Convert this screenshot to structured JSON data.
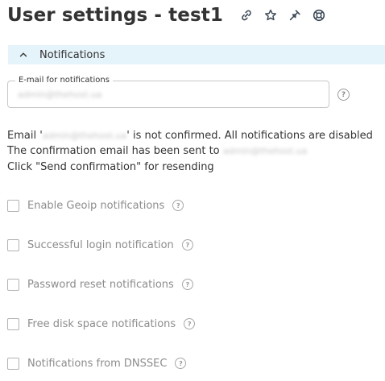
{
  "header": {
    "title": "User settings - test1",
    "icons": [
      "link-icon",
      "star-icon",
      "pin-icon",
      "help-ring-icon"
    ]
  },
  "section": {
    "title": "Notifications",
    "icon": "chevron-up-icon",
    "expanded": true
  },
  "email_field": {
    "legend": "E-mail for notifications",
    "value": "admin@thehost.ua"
  },
  "status_message": {
    "line1_prefix": "Email '",
    "line1_email": "admin@thehost.ua",
    "line1_suffix": "' is not confirmed. All notifications are disabled",
    "line2_prefix": "The confirmation email has been sent to ",
    "line2_email": "admin@thehost.ua",
    "line3": "Click \"Send confirmation\" for resending"
  },
  "help_glyph": "?",
  "options": [
    {
      "label": "Enable Geoip notifications",
      "checked": false
    },
    {
      "label": "Successful login notification",
      "checked": false
    },
    {
      "label": "Password reset notifications",
      "checked": false
    },
    {
      "label": "Free disk space notifications",
      "checked": false
    },
    {
      "label": "Notifications from DNSSEC",
      "checked": false
    }
  ],
  "colors": {
    "section_header_bg": "#e5f3fa",
    "text": "#333333",
    "disabled_text": "#8c8c8c",
    "icon": "#3d4a57"
  }
}
